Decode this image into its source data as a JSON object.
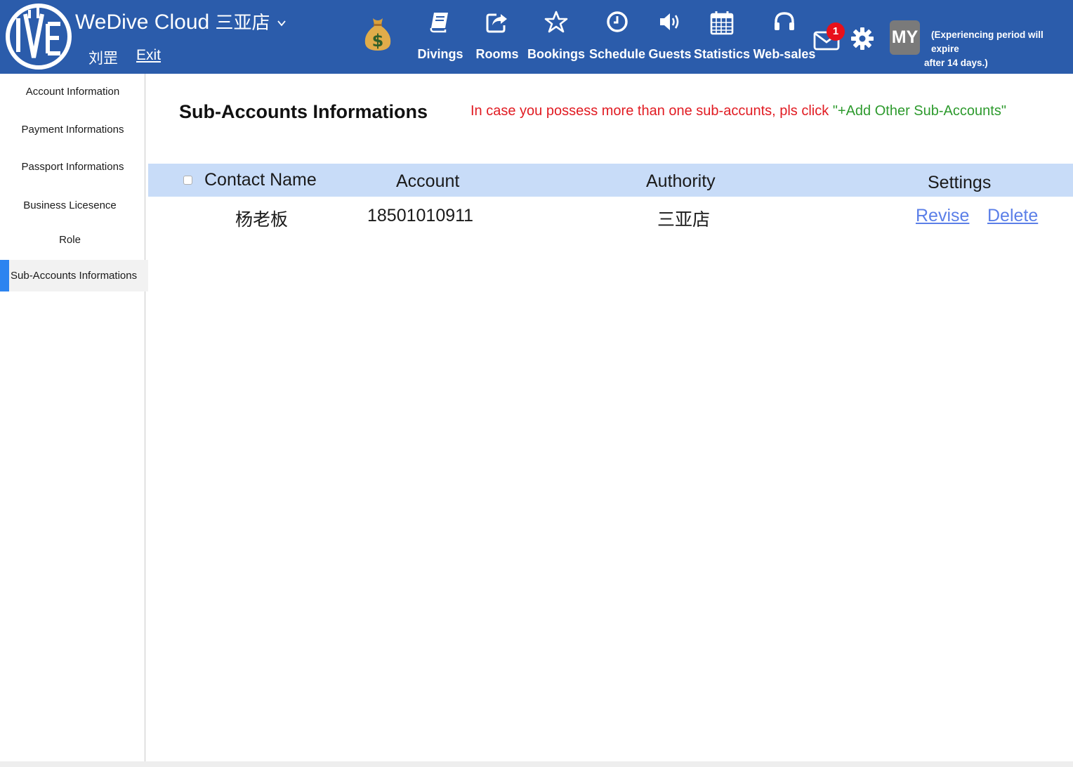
{
  "header": {
    "brand": "WeDive Cloud",
    "store": "三亚店",
    "user_name": "刘罡",
    "exit_label": "Exit",
    "nav": [
      {
        "label": "Divings",
        "icon": "book-icon"
      },
      {
        "label": "Rooms",
        "icon": "share-icon"
      },
      {
        "label": "Bookings",
        "icon": "star-icon"
      },
      {
        "label": "Schedule",
        "icon": "clock-icon"
      },
      {
        "label": "Guests",
        "icon": "speaker-icon"
      },
      {
        "label": "Statistics",
        "icon": "calendar-icon"
      },
      {
        "label": "Web-sales",
        "icon": "headphones-icon"
      }
    ],
    "mail_count": "1",
    "avatar_initials": "MY",
    "trial_notice_line1": "(Experiencing period will expire",
    "trial_notice_line2": "after 14 days.)"
  },
  "sidebar": {
    "items": [
      {
        "label": "Account Information"
      },
      {
        "label": "Payment Informations"
      },
      {
        "label": "Passport Informations"
      },
      {
        "label": "Business Licesence"
      },
      {
        "label": "Role"
      },
      {
        "label": "Sub-Accounts Informations",
        "active": true
      }
    ]
  },
  "main": {
    "title": "Sub-Accounts Informations",
    "hint_prefix": "In case you possess more than one sub-accunts, pls click ",
    "hint_action": "\"+Add Other Sub-Accounts\"",
    "table": {
      "columns": [
        "Contact Name",
        "Account",
        "Authority",
        "Settings"
      ],
      "rows": [
        {
          "contact_name": "杨老板",
          "account": "18501010911",
          "authority": "三亚店",
          "actions": [
            "Revise",
            "Delete"
          ]
        }
      ]
    }
  },
  "colors": {
    "header_bg": "#2b5cab",
    "table_header_bg": "#c8dcf8",
    "active_marker": "#2d84f0",
    "hint_red": "#e11b22",
    "hint_green": "#2d9a2d",
    "link": "#5b7fe8",
    "badge": "#e8101a"
  }
}
